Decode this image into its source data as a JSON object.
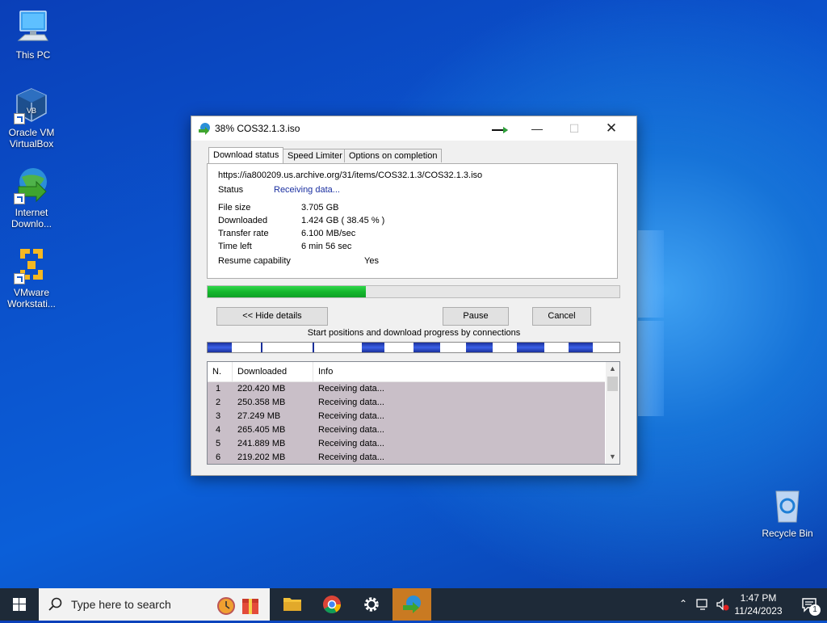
{
  "desktop": {
    "icons": [
      {
        "label": "This PC"
      },
      {
        "label": "Oracle VM VirtualBox"
      },
      {
        "label": "Internet Downlo..."
      },
      {
        "label": "VMware Workstati..."
      }
    ],
    "recycle_bin": "Recycle Bin"
  },
  "dialog": {
    "title": "38% COS32.1.3.iso",
    "tabs": [
      "Download status",
      "Speed Limiter",
      "Options on completion"
    ],
    "url": "https://ia800209.us.archive.org/31/items/COS32.1.3/COS32.1.3.iso",
    "status_label": "Status",
    "status_value": "Receiving data...",
    "file_size_label": "File size",
    "file_size_value": "3.705  GB",
    "downloaded_label": "Downloaded",
    "downloaded_value": "1.424  GB  ( 38.45 % )",
    "transfer_rate_label": "Transfer rate",
    "transfer_rate_value": "6.100  MB/sec",
    "time_left_label": "Time left",
    "time_left_value": "6 min 56 sec",
    "resume_label": "Resume capability",
    "resume_value": "Yes",
    "progress_fraction": 0.3845,
    "hide_details_label": "<< Hide details",
    "pause_label": "Pause",
    "cancel_label": "Cancel",
    "connections_caption": "Start positions and download progress by connections",
    "columns": [
      "N.",
      "Downloaded",
      "Info"
    ],
    "connections": [
      {
        "n": "1",
        "downloaded": "220.420  MB",
        "info": "Receiving data..."
      },
      {
        "n": "2",
        "downloaded": "250.358  MB",
        "info": "Receiving data..."
      },
      {
        "n": "3",
        "downloaded": "27.249  MB",
        "info": "Receiving data..."
      },
      {
        "n": "4",
        "downloaded": "265.405  MB",
        "info": "Receiving data..."
      },
      {
        "n": "5",
        "downloaded": "241.889  MB",
        "info": "Receiving data..."
      },
      {
        "n": "6",
        "downloaded": "219.202  MB",
        "info": "Receiving data..."
      }
    ]
  },
  "taskbar": {
    "search_placeholder": "Type here to search",
    "time": "1:47 PM",
    "date": "11/24/2023",
    "notification_count": "1"
  }
}
